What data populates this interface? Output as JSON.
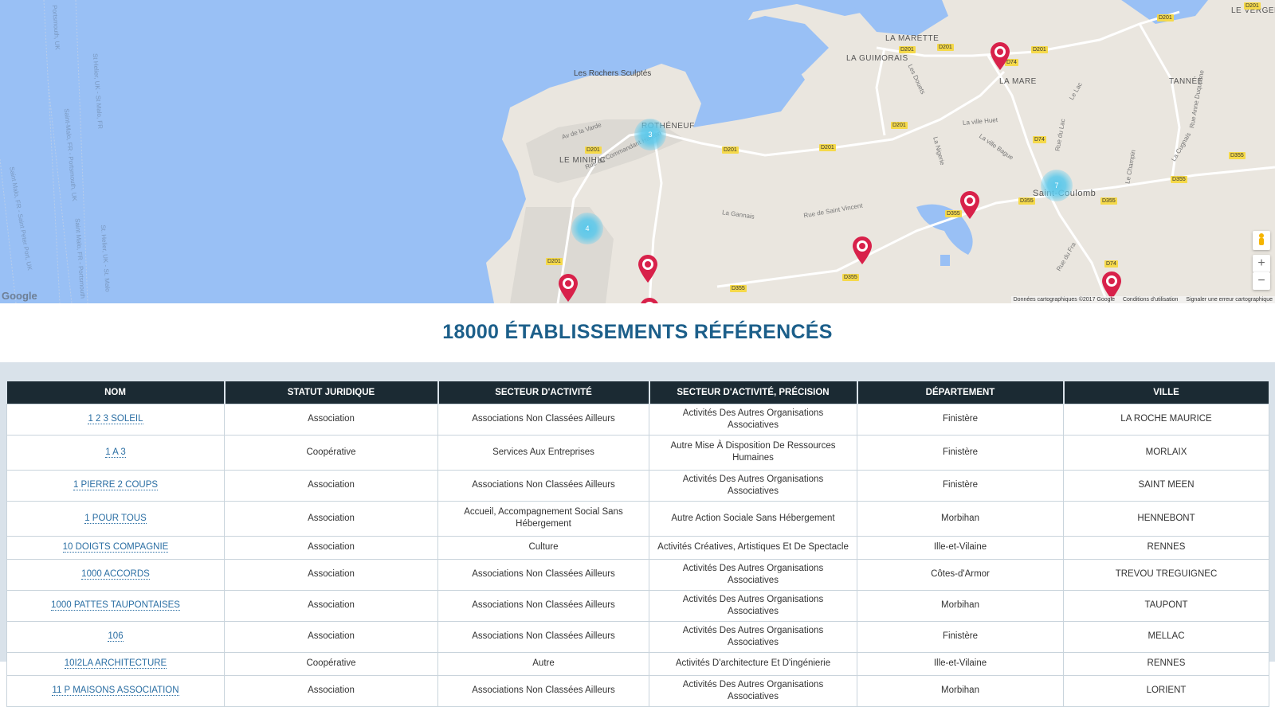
{
  "map": {
    "places": {
      "le_verger": "LE VERGER",
      "la_marette": "LA MARETTE",
      "la_guimorais": "LA GUIMORAIS",
      "la_mare": "LA MARE",
      "tannee": "TANNÉE",
      "rotheneuf": "ROTHÉNEUF",
      "le_minihic": "LE MINIHIC",
      "saint_coulomb": "Saint-Coulomb"
    },
    "poi": "Les Rochers Sculptés",
    "roads": {
      "d201": "D201",
      "d74": "D74",
      "d355": "D355"
    },
    "streets": {
      "av_varde": "Av de la Varde",
      "rue_commandant": "Rue du Commandant Hamon",
      "la_gannais": "La Gannais",
      "rue_saint_vincent": "Rue de Saint Vincent",
      "la_ville_huet": "La ville Huet",
      "la_ville_bague": "La ville Bague",
      "la_nigerie": "La Nigerie",
      "les_douets": "Les Douets",
      "le_lac": "Le Lac",
      "rue_du_lac": "Rue du Lac",
      "rue_anne_duquesne": "Rue Anne Duquesne",
      "la_cugnais": "La Cugnais",
      "le_champin": "Le Champin",
      "rue_du_fra": "Rue du Fra"
    },
    "ferry_routes": [
      "Portsmouth, UK",
      "St Helier, UK - St Malo, FR",
      "Saint-Malo, FR - Portsmouth, UK",
      "Saint Malo, FR - Saint Peter Port, UK",
      "Saint Malo, FR - Portsmouth",
      "St. Helier, UK - St. Malo"
    ],
    "clusters": [
      "3",
      "4",
      "7"
    ],
    "google_logo": "Google",
    "footer": {
      "data": "Données cartographiques ©2017 Google",
      "terms": "Conditions d'utilisation",
      "report": "Signaler une erreur cartographique"
    },
    "zoom_in": "+",
    "zoom_out": "−"
  },
  "heading": "18000 ÉTABLISSEMENTS RÉFÉRENCÉS",
  "table": {
    "columns": [
      "NOM",
      "STATUT JURIDIQUE",
      "SECTEUR D'ACTIVITÉ",
      "SECTEUR D'ACTIVITÉ, PRÉCISION",
      "DÉPARTEMENT",
      "VILLE"
    ],
    "rows": [
      [
        "1 2 3 SOLEIL",
        "Association",
        "Associations Non Classées Ailleurs",
        "Activités Des Autres Organisations Associatives",
        "Finistère",
        "LA ROCHE MAURICE"
      ],
      [
        "1 A 3",
        "Coopérative",
        "Services Aux Entreprises",
        "Autre Mise À Disposition De Ressources Humaines",
        "Finistère",
        "MORLAIX"
      ],
      [
        "1 PIERRE 2 COUPS",
        "Association",
        "Associations Non Classées Ailleurs",
        "Activités Des Autres Organisations Associatives",
        "Finistère",
        "SAINT MEEN"
      ],
      [
        "1 POUR TOUS",
        "Association",
        "Accueil, Accompagnement Social Sans Hébergement",
        "Autre Action Sociale Sans Hébergement",
        "Morbihan",
        "HENNEBONT"
      ],
      [
        "10 DOIGTS COMPAGNIE",
        "Association",
        "Culture",
        "Activités Créatives, Artistiques Et De Spectacle",
        "Ille-et-Vilaine",
        "RENNES"
      ],
      [
        "1000 ACCORDS",
        "Association",
        "Associations Non Classées Ailleurs",
        "Activités Des Autres Organisations Associatives",
        "Côtes-d'Armor",
        "TREVOU TREGUIGNEC"
      ],
      [
        "1000 PATTES TAUPONTAISES",
        "Association",
        "Associations Non Classées Ailleurs",
        "Activités Des Autres Organisations Associatives",
        "Morbihan",
        "TAUPONT"
      ],
      [
        "106",
        "Association",
        "Associations Non Classées Ailleurs",
        "Activités Des Autres Organisations Associatives",
        "Finistère",
        "MELLAC"
      ],
      [
        "10I2LA ARCHITECTURE",
        "Coopérative",
        "Autre",
        "Activités D'architecture Et D'ingénierie",
        "Ille-et-Vilaine",
        "RENNES"
      ],
      [
        "11 P MAISONS ASSOCIATION",
        "Association",
        "Associations Non Classées Ailleurs",
        "Activités Des Autres Organisations Associatives",
        "Morbihan",
        "LORIENT"
      ]
    ]
  }
}
